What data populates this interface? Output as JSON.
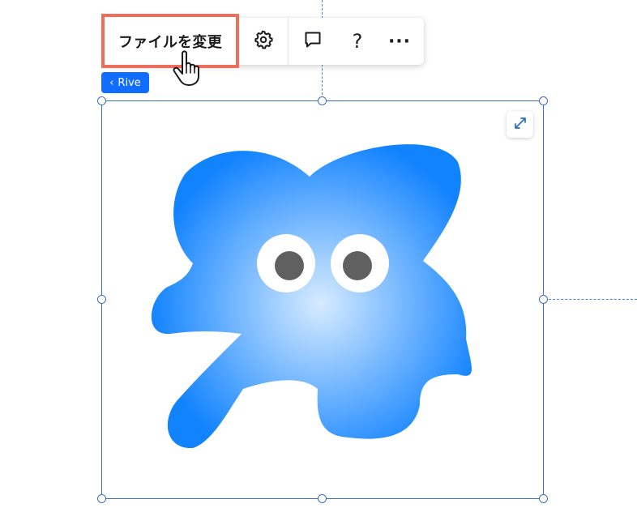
{
  "toolbar": {
    "change_file_label": "ファイルを変更",
    "settings_icon": "gear-icon",
    "comment_icon": "comment-icon",
    "help_icon": "question-icon",
    "more_icon": "more-dots-icon",
    "help_glyph": "?",
    "more_glyph": "···"
  },
  "breadcrumb": {
    "chevron": "‹",
    "label": "Rive"
  },
  "canvas": {
    "element": "rive-animation",
    "expand_icon": "expand-arrows-icon"
  },
  "colors": {
    "accent": "#116dff",
    "selection": "#3a6fc4",
    "highlight": "#ee6e5c",
    "blob_center": "#d6ebff",
    "blob_edge": "#1283ff",
    "eye_pupil": "#606060"
  }
}
